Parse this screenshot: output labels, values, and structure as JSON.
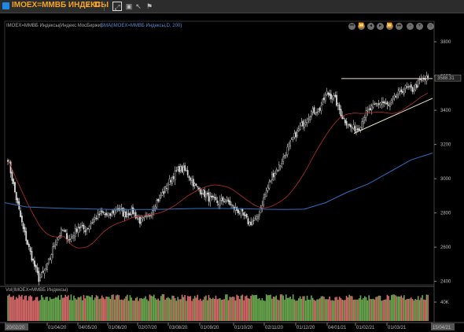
{
  "toolbar": {
    "symbol": "IMOEX=ММВБ ИНДЕКСЫ",
    "timeframe": "D",
    "icons": [
      "line-icon",
      "trendline-icon",
      "ray-icon",
      "arrow-icon",
      "fib-icon",
      "cross-icon",
      "rect-icon",
      "text-icon",
      "channel-icon",
      "circle-icon",
      "square-icon",
      "left-arrow-icon",
      "right-arrow-icon",
      "undo-icon",
      "redo-icon",
      "trash-icon"
    ]
  },
  "legend": {
    "price": "IMOEX=ММВБ Индексы(Индекс МосБиржи)",
    "sma": "SMA(IMOEX=ММВБ Индексы,D, 200)",
    "volume": "Vol(IMOEX=ММВБ Индексы)"
  },
  "colors": {
    "candle": "#d9d9d9",
    "sma_long": "#2f6fc4",
    "sma_short": "#b8302a",
    "trend": "#e8e0c8",
    "vol_up": "#6aa84f",
    "vol_down": "#d96a6a"
  },
  "price_axis": {
    "ticks": [
      "3800",
      "3600",
      "3400",
      "3200",
      "3000",
      "2800",
      "2600",
      "2400"
    ],
    "current": "3588.31",
    "vol_tick": "40K"
  },
  "date_axis": [
    "20/02/20",
    "01/04/20",
    "04/05/20",
    "01/06/20",
    "02/07/20",
    "03/08/20",
    "01/09/20",
    "01/10/20",
    "02/11/20",
    "01/12/20",
    "04/01/21",
    "01/02/21",
    "01/03/21",
    "15/04/21"
  ],
  "chart_data": {
    "type": "candlestick",
    "title": "IMOEX=ММВБ Индексы(Индекс МосБиржи)",
    "xlabel": "",
    "ylabel": "",
    "ylim": [
      2380,
      3920
    ],
    "x_range": [
      "20/02/20",
      "15/04/21"
    ],
    "series": [
      {
        "name": "IMOEX=ММВБ Индексы",
        "type": "candles",
        "close_path": [
          3120,
          2900,
          2700,
          2550,
          2410,
          2480,
          2620,
          2700,
          2640,
          2720,
          2700,
          2760,
          2800,
          2780,
          2830,
          2790,
          2810,
          2750,
          2770,
          2860,
          2920,
          3000,
          3060,
          3040,
          2960,
          2920,
          2880,
          2860,
          2880,
          2830,
          2800,
          2740,
          2760,
          2900,
          3020,
          3080,
          3180,
          3260,
          3330,
          3390,
          3400,
          3500,
          3470,
          3360,
          3300,
          3290,
          3380,
          3420,
          3450,
          3420,
          3490,
          3530,
          3520,
          3570,
          3588
        ]
      },
      {
        "name": "SMA(IMOEX=ММВБ Индексы,D, 200)",
        "values": [
          2860,
          2835,
          2830,
          2826,
          2823,
          2820,
          2820,
          2820,
          2823,
          2826,
          2826,
          2825,
          2822,
          2820,
          2822,
          2860,
          2920,
          2970,
          3040,
          3110,
          3150
        ]
      }
    ],
    "volume": {
      "label": "Vol(IMOEX=ММВБ Индексы)",
      "tick": "40K"
    },
    "current_price": 3588.31,
    "grid": false,
    "legend": "top-left"
  }
}
